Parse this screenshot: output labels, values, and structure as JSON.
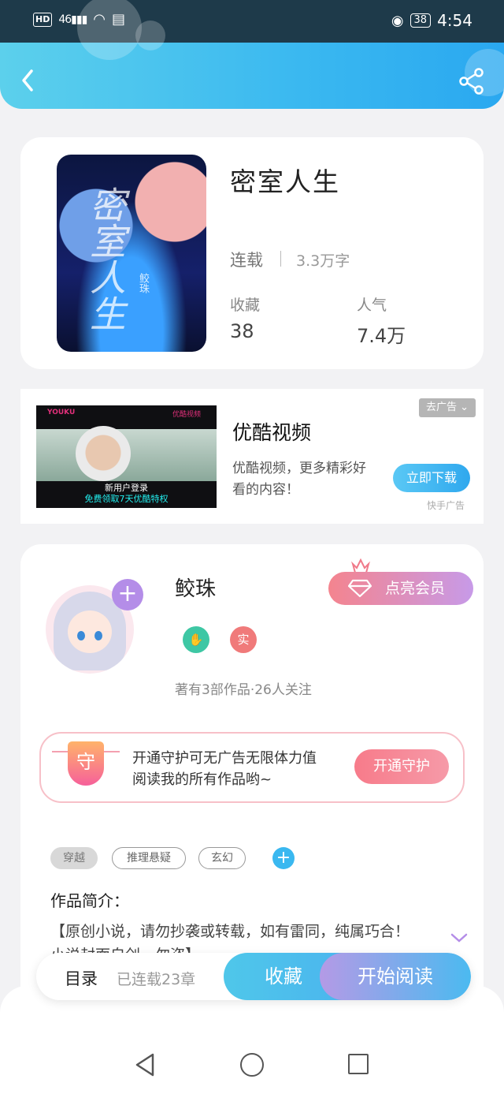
{
  "status_bar": {
    "hd": "HD",
    "network": "46",
    "battery": "38",
    "time": "4:54"
  },
  "header": {
    "back_icon": "chevron-left-icon",
    "share_icon": "share-icon"
  },
  "book": {
    "cover_title": "密室人生",
    "cover_author": "鲛珠",
    "title": "密室人生",
    "status": "连载",
    "word_count": "3.3万字",
    "favorites_label": "收藏",
    "favorites_value": "38",
    "popularity_label": "人气",
    "popularity_value": "7.4万"
  },
  "ad": {
    "close_label": "去广告",
    "title": "优酷视频",
    "description": "优酷视频，更多精彩好看的内容！",
    "button_label": "立即下载",
    "source": "快手广告",
    "image": {
      "brand_left": "YOUKU",
      "brand_right": "优酷视频",
      "promo_line1": "新用户登录",
      "promo_line2": "免费领取7天优酷特权"
    }
  },
  "author": {
    "name": "鲛珠",
    "follow_icon": "plus-icon",
    "badge_verified": "实",
    "stats": "著有3部作品·26人关注",
    "vip_button": "点亮会员"
  },
  "guard": {
    "shield_char": "守",
    "text_line1": "开通守护可无广告无限体力值",
    "text_line2": "阅读我的所有作品哟~",
    "button_label": "开通守护"
  },
  "tags": [
    "穿越",
    "推理悬疑",
    "玄幻"
  ],
  "intro": {
    "title": "作品简介：",
    "text": "【原创小说，请勿抄袭或转载，如有雷同，纯属巧合！小说封面自创，勿盗】"
  },
  "bottom_bar": {
    "toc_label": "目录",
    "chapter_count": "已连载23章",
    "favorite_label": "收藏",
    "read_label": "开始阅读"
  },
  "colors": {
    "header_accent": "#3ab8f0",
    "vip_pink": "#f4848e",
    "read_purple": "#b49ae6"
  }
}
